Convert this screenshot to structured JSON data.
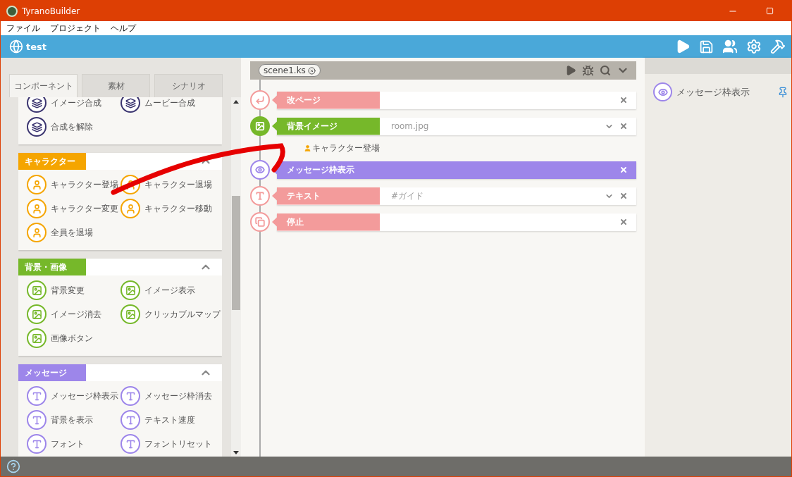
{
  "window": {
    "title": "TyranoBuilder"
  },
  "menu": [
    "ファイル",
    "プロジェクト",
    "ヘルプ"
  ],
  "project": {
    "name": "test"
  },
  "component_panel": {
    "tabs": [
      {
        "label": "コンポーネント",
        "selected": true
      },
      {
        "label": "素材",
        "selected": false
      },
      {
        "label": "シナリオ",
        "selected": false
      }
    ],
    "sections": [
      {
        "color": "#3b3570",
        "items": [
          "イメージ合成",
          "ムービー合成",
          "合成を解除"
        ]
      },
      {
        "title": "キャラクター",
        "color": "#f5a500",
        "expanded": true,
        "items": [
          "キャラクター登場",
          "キャラクター退場",
          "キャラクター変更",
          "キャラクター移動",
          "全員を退場"
        ]
      },
      {
        "title": "背景・画像",
        "color": "#76b82a",
        "expanded": true,
        "items": [
          "背景変更",
          "イメージ表示",
          "イメージ消去",
          "クリッカブルマップ",
          "画像ボタン"
        ]
      },
      {
        "title": "メッセージ",
        "color": "#9d86ea",
        "expanded": true,
        "items": [
          "メッセージ枠表示",
          "メッセージ枠消去",
          "背景を表示",
          "テキスト速度",
          "フォント",
          "フォントリセット"
        ]
      }
    ]
  },
  "editor": {
    "file_tab": "scene1.ks",
    "rows": [
      {
        "kind": "tag",
        "label": "改ページ",
        "color": "#f39b9b",
        "dropdown": false,
        "selected": false
      },
      {
        "kind": "tag",
        "label": "背景イメージ",
        "color": "#76b82a",
        "value": "room.jpg",
        "dropdown": true,
        "selected": false
      },
      {
        "kind": "sub",
        "label": "キャラクター登場",
        "selected": false
      },
      {
        "kind": "tag",
        "label": "メッセージ枠表示",
        "color": "#9d86ea",
        "dropdown": false,
        "selected": true
      },
      {
        "kind": "tag",
        "label": "テキスト",
        "color": "#f39b9b",
        "value": "#ガイド",
        "dropdown": true,
        "selected": false
      },
      {
        "kind": "tag",
        "label": "停止",
        "color": "#f39b9b",
        "dropdown": false,
        "selected": false
      }
    ]
  },
  "right_panel": {
    "items": [
      "メッセージ枠表示"
    ]
  }
}
